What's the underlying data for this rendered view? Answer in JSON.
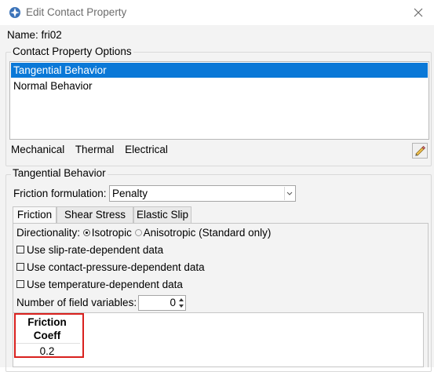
{
  "window": {
    "title": "Edit Contact Property",
    "title_icon": "abaqus-app-icon",
    "close_icon": "close-icon"
  },
  "name": {
    "label": "Name:",
    "value": "fri02"
  },
  "options_group": {
    "label": "Contact Property Options",
    "items": [
      {
        "label": "Tangential Behavior",
        "selected": true
      },
      {
        "label": "Normal Behavior",
        "selected": false
      }
    ]
  },
  "menus": [
    "Mechanical",
    "Thermal",
    "Electrical"
  ],
  "edit_icon": "pencil-icon",
  "behavior_group": {
    "label": "Tangential Behavior"
  },
  "friction_formulation": {
    "label": "Friction formulation:",
    "value": "Penalty"
  },
  "tabs": [
    {
      "label": "Friction",
      "active": true
    },
    {
      "label": "Shear Stress",
      "active": false
    },
    {
      "label": "Elastic Slip",
      "active": false
    }
  ],
  "directionality": {
    "label": "Directionality:",
    "options": [
      {
        "label": "Isotropic",
        "selected": true
      },
      {
        "label": "Anisotropic (Standard only)",
        "selected": false
      }
    ]
  },
  "checkboxes": [
    {
      "label": "Use slip-rate-dependent data",
      "checked": false
    },
    {
      "label": "Use contact-pressure-dependent data",
      "checked": false
    },
    {
      "label": "Use temperature-dependent data",
      "checked": false
    }
  ],
  "field_variables": {
    "label": "Number of field variables:",
    "value": "0"
  },
  "table": {
    "header_line1": "Friction",
    "header_line2": "Coeff",
    "rows": [
      "0.2"
    ]
  },
  "colors": {
    "selection": "#0a78d7",
    "highlight_box": "#d9211e"
  }
}
